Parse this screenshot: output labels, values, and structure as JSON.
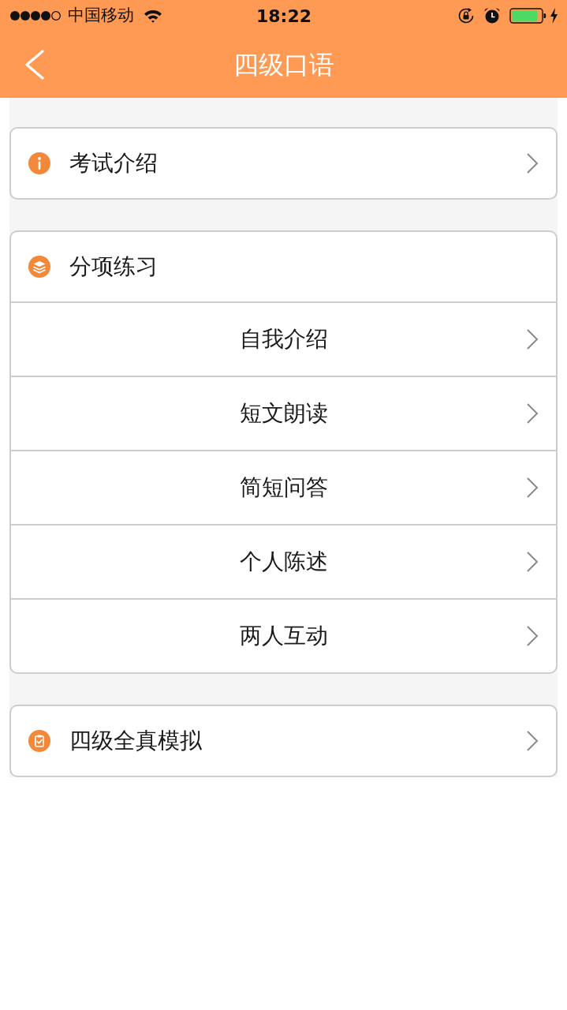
{
  "status_bar": {
    "carrier": "中国移动",
    "time": "18:22"
  },
  "nav_bar": {
    "title": "四级口语"
  },
  "sections": [
    {
      "kind": "link",
      "label": "考试介绍"
    },
    {
      "kind": "group",
      "label": "分项练习",
      "items": [
        {
          "label": "自我介绍"
        },
        {
          "label": "短文朗读"
        },
        {
          "label": "简短问答"
        },
        {
          "label": "个人陈述"
        },
        {
          "label": "两人互动"
        }
      ]
    },
    {
      "kind": "link",
      "label": "四级全真模拟"
    }
  ]
}
